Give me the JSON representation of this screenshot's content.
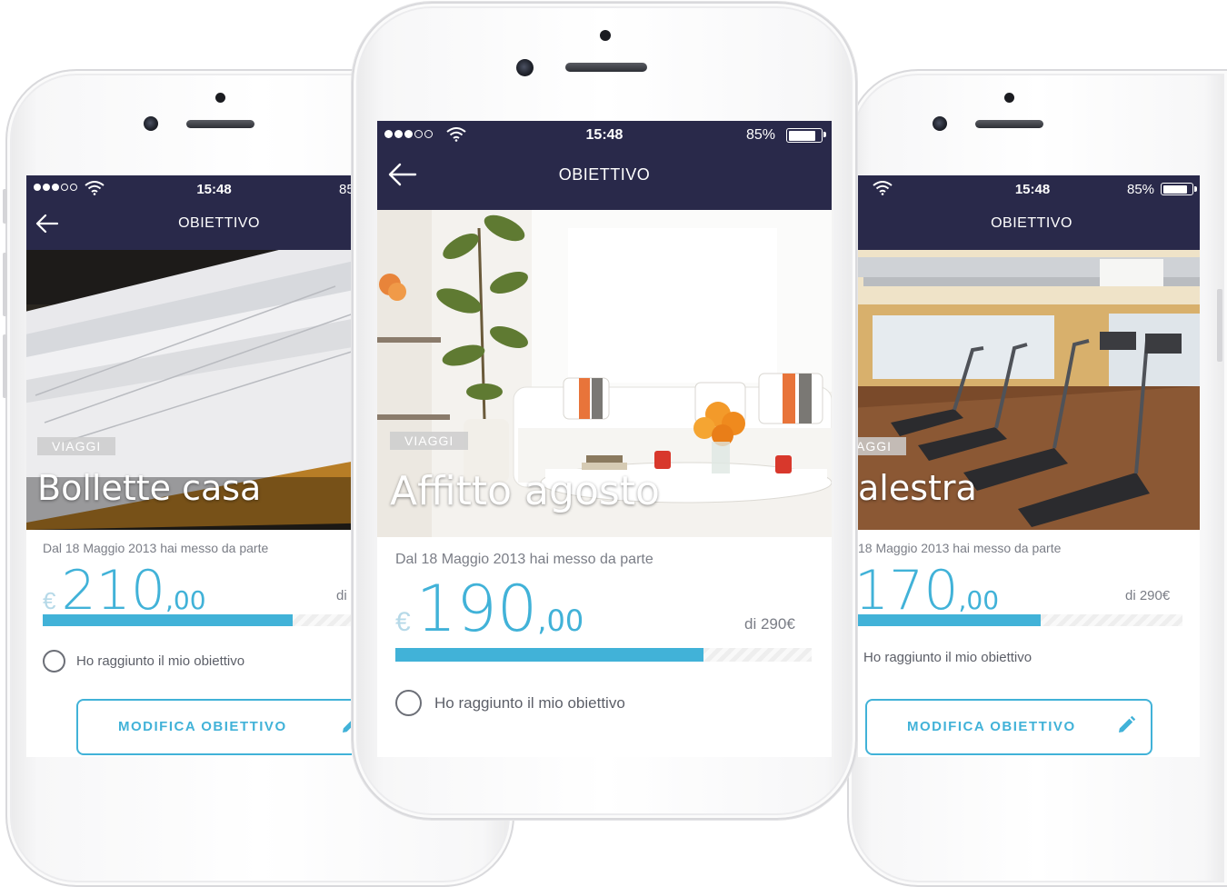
{
  "colors": {
    "navbar": "#29294a",
    "accent": "#41b2d8",
    "text_muted": "#7a7d86",
    "tag_background": "#cdcdcd"
  },
  "phones": {
    "left": {
      "status": {
        "time": "15:48",
        "battery": "85",
        "signal_bars": 3,
        "icon": "wifi-icon"
      },
      "nav": {
        "back_icon": "back-arrow-icon",
        "title": "OBIETTIVO"
      },
      "hero": {
        "photo": "stacked-envelopes-photo",
        "tag": "VIAGGI",
        "title": "Bollette casa"
      },
      "saved_since": "Dal 18 Maggio 2013 hai messo da parte",
      "amount": {
        "currency": "€",
        "integer": "210",
        "decimal": ",00"
      },
      "target": "di",
      "progress": 0.72,
      "reached_label": "Ho raggiunto il mio obiettivo",
      "edit_button": {
        "label": "MODIFICA OBIETTIVO",
        "icon": "pencil-icon"
      }
    },
    "center": {
      "status": {
        "time": "15:48",
        "battery": "85%",
        "signal_bars": 3,
        "icon": "wifi-icon"
      },
      "nav": {
        "back_icon": "back-arrow-icon",
        "title": "OBIETTIVO"
      },
      "hero": {
        "photo": "living-room-photo",
        "tag": "VIAGGI",
        "title": "Affitto agosto"
      },
      "saved_since": "Dal 18 Maggio 2013 hai messo da parte",
      "amount": {
        "currency": "€",
        "integer": "190",
        "decimal": ",00"
      },
      "target": "di 290€",
      "progress": 0.74,
      "reached_label": "Ho raggiunto il mio obiettivo"
    },
    "right": {
      "status": {
        "time": "15:48",
        "battery": "85%",
        "icon": "wifi-icon"
      },
      "nav": {
        "title": "OBIETTIVO"
      },
      "hero": {
        "photo": "gym-treadmills-photo",
        "tag": "AGGI",
        "title": "alestra"
      },
      "saved_since": "18 Maggio 2013 hai messo da parte",
      "amount": {
        "integer": "170",
        "decimal": ",00"
      },
      "target": "di 290€",
      "progress": 0.59,
      "reached_label": "Ho raggiunto il mio obiettivo",
      "edit_button": {
        "label": "MODIFICA OBIETTIVO",
        "icon": "pencil-icon"
      }
    }
  }
}
